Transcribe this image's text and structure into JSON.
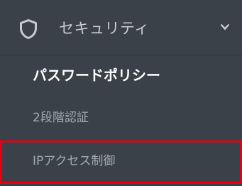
{
  "sidebar": {
    "group": {
      "icon": "shield-icon",
      "label": "セキュリティ",
      "chevron": "chevron-down-icon",
      "expanded": true
    },
    "items": [
      {
        "label": "パスワードポリシー",
        "active": true
      },
      {
        "label": "2段階認証",
        "active": false
      },
      {
        "label": "IPアクセス制御",
        "active": false,
        "highlighted": true
      }
    ]
  },
  "colors": {
    "background": "#3b4148",
    "active_text": "#ffffff",
    "inactive_text": "#a3a9b0",
    "highlight_border": "#e60012"
  }
}
